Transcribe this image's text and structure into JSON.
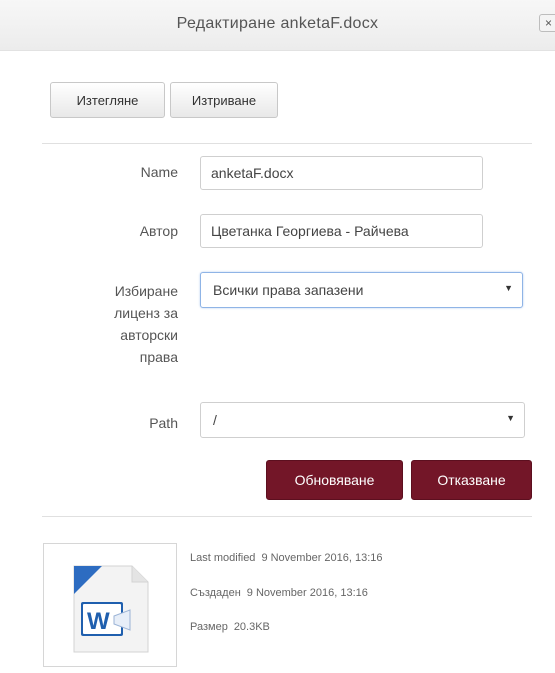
{
  "dialog": {
    "title": "Редактиране anketaF.docx",
    "close_label": "×"
  },
  "toolbar": {
    "download_label": "Изтегляне",
    "delete_label": "Изтриване"
  },
  "form": {
    "name": {
      "label": "Name",
      "value": "anketaF.docx"
    },
    "author": {
      "label": "Автор",
      "value": "Цветанка Георгиева - Райчева"
    },
    "license": {
      "label_lines": [
        "Избиране",
        "лиценз за",
        "авторски",
        "права"
      ],
      "selected": "Всички права запазени"
    },
    "path": {
      "label": "Path",
      "selected": "/"
    }
  },
  "actions": {
    "update_label": "Обновяване",
    "cancel_label": "Отказване"
  },
  "file_info": {
    "icon": "word-document-icon",
    "last_modified_label": "Last modified",
    "last_modified_value": "9 November 2016, 13:16",
    "created_label": "Създаден",
    "created_value": "9 November 2016, 13:16",
    "size_label": "Размер",
    "size_value": "20.3KB"
  },
  "colors": {
    "primary_button": "#731628",
    "focus_border": "#8fb4e6"
  }
}
